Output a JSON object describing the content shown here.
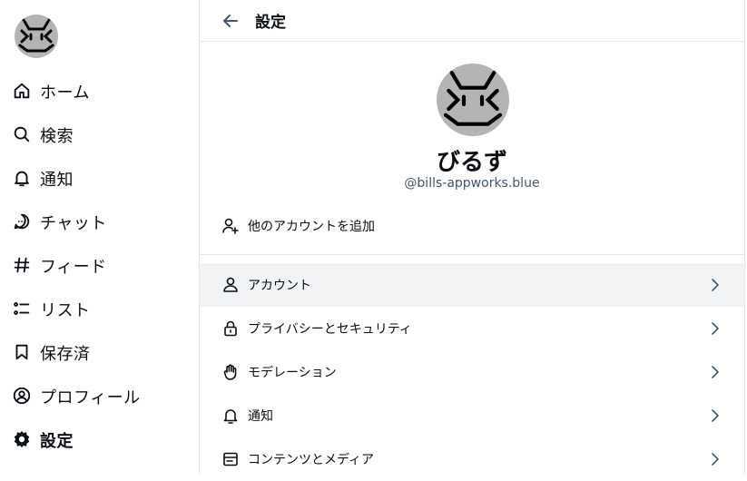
{
  "sidebar": {
    "items": [
      {
        "label": "ホーム",
        "icon": "home-icon"
      },
      {
        "label": "検索",
        "icon": "search-icon"
      },
      {
        "label": "通知",
        "icon": "bell-icon"
      },
      {
        "label": "チャット",
        "icon": "chat-icon"
      },
      {
        "label": "フィード",
        "icon": "hash-icon"
      },
      {
        "label": "リスト",
        "icon": "list-icon"
      },
      {
        "label": "保存済",
        "icon": "bookmark-icon"
      },
      {
        "label": "プロフィール",
        "icon": "profile-icon"
      },
      {
        "label": "設定",
        "icon": "gear-icon",
        "active": true
      }
    ]
  },
  "header": {
    "title": "設定"
  },
  "profile": {
    "name": "びるず",
    "handle": "@bills-appworks.blue",
    "add_account_label": "他のアカウントを追加"
  },
  "settings": {
    "items": [
      {
        "label": "アカウント",
        "icon": "person-icon"
      },
      {
        "label": "プライバシーとセキュリティ",
        "icon": "lock-icon"
      },
      {
        "label": "モデレーション",
        "icon": "hand-icon"
      },
      {
        "label": "通知",
        "icon": "bell-icon"
      },
      {
        "label": "コンテンツとメディア",
        "icon": "window-icon"
      }
    ]
  },
  "colors": {
    "text": "#0b0f14",
    "muted": "#42576c",
    "hover": "#f1f3f5",
    "border": "#e3e6ea",
    "avatar_bg": "#b4b4b4"
  }
}
